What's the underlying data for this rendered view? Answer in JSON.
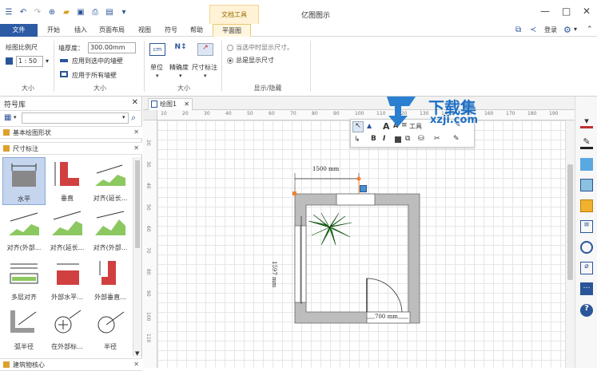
{
  "app": {
    "title": "亿图图示",
    "context_tab_group": "文档工具"
  },
  "window_controls": {
    "minimize": "—",
    "maximize": "□",
    "close": "✕"
  },
  "menu": {
    "file": "文件",
    "items": [
      "开始",
      "插入",
      "页面布局",
      "视图",
      "符号",
      "帮助"
    ],
    "active": "平面图",
    "login": "登录"
  },
  "ribbon": {
    "scale": {
      "label": "绘图比例尺",
      "value": "1 : 50",
      "group": "大小"
    },
    "wall": {
      "label": "墙厚度：",
      "value": "300.00mm",
      "apply_selected": "应用到选中的墙壁",
      "apply_all": "应用于所有墙壁",
      "group": "大小"
    },
    "units": {
      "unit": "单位",
      "precision": "精确度",
      "dimension": "尺寸标注",
      "group": "大小"
    },
    "display": {
      "when_selected": "当选中时显示尺寸。",
      "always": "总是显示尺寸",
      "group": "显示/隐藏"
    }
  },
  "panel": {
    "title": "符号库",
    "categories": [
      {
        "label": "基本绘图形状"
      },
      {
        "label": "尺寸标注"
      },
      {
        "label": "建筑物核心"
      }
    ],
    "symbols": [
      {
        "label": "水平",
        "selected": true
      },
      {
        "label": "垂直"
      },
      {
        "label": "对齐(延长..."
      },
      {
        "label": "对齐(外部..."
      },
      {
        "label": "对齐(延长..."
      },
      {
        "label": "对齐(外部..."
      },
      {
        "label": "多层对齐"
      },
      {
        "label": "外部水平..."
      },
      {
        "label": "外部垂直..."
      },
      {
        "label": "弧半径"
      },
      {
        "label": "在外部标..."
      },
      {
        "label": "半径"
      }
    ]
  },
  "document": {
    "tab": "绘图1"
  },
  "ruler": {
    "top": [
      "10",
      "20",
      "30",
      "40",
      "50",
      "60",
      "70",
      "80",
      "90",
      "100",
      "110",
      "120",
      "130",
      "140",
      "150",
      "160",
      "170",
      "180",
      "190"
    ],
    "left": [
      "20",
      "30",
      "40",
      "50",
      "60",
      "70",
      "80",
      "90",
      "100",
      "110"
    ]
  },
  "floor_plan": {
    "top_dim": "1500 mm",
    "left_dim": "1597 mm",
    "door_dim": "700 mm"
  },
  "float_toolbar": {
    "font_a": "A",
    "font_a2": "A",
    "bold": "B",
    "italic": "I",
    "tool_label": "工具"
  },
  "watermark": {
    "title": "下载集",
    "url": "xzji.com"
  },
  "colors": {
    "accent": "#2c5aa4",
    "context": "#f1c232",
    "wall": "#bdbdbd"
  }
}
